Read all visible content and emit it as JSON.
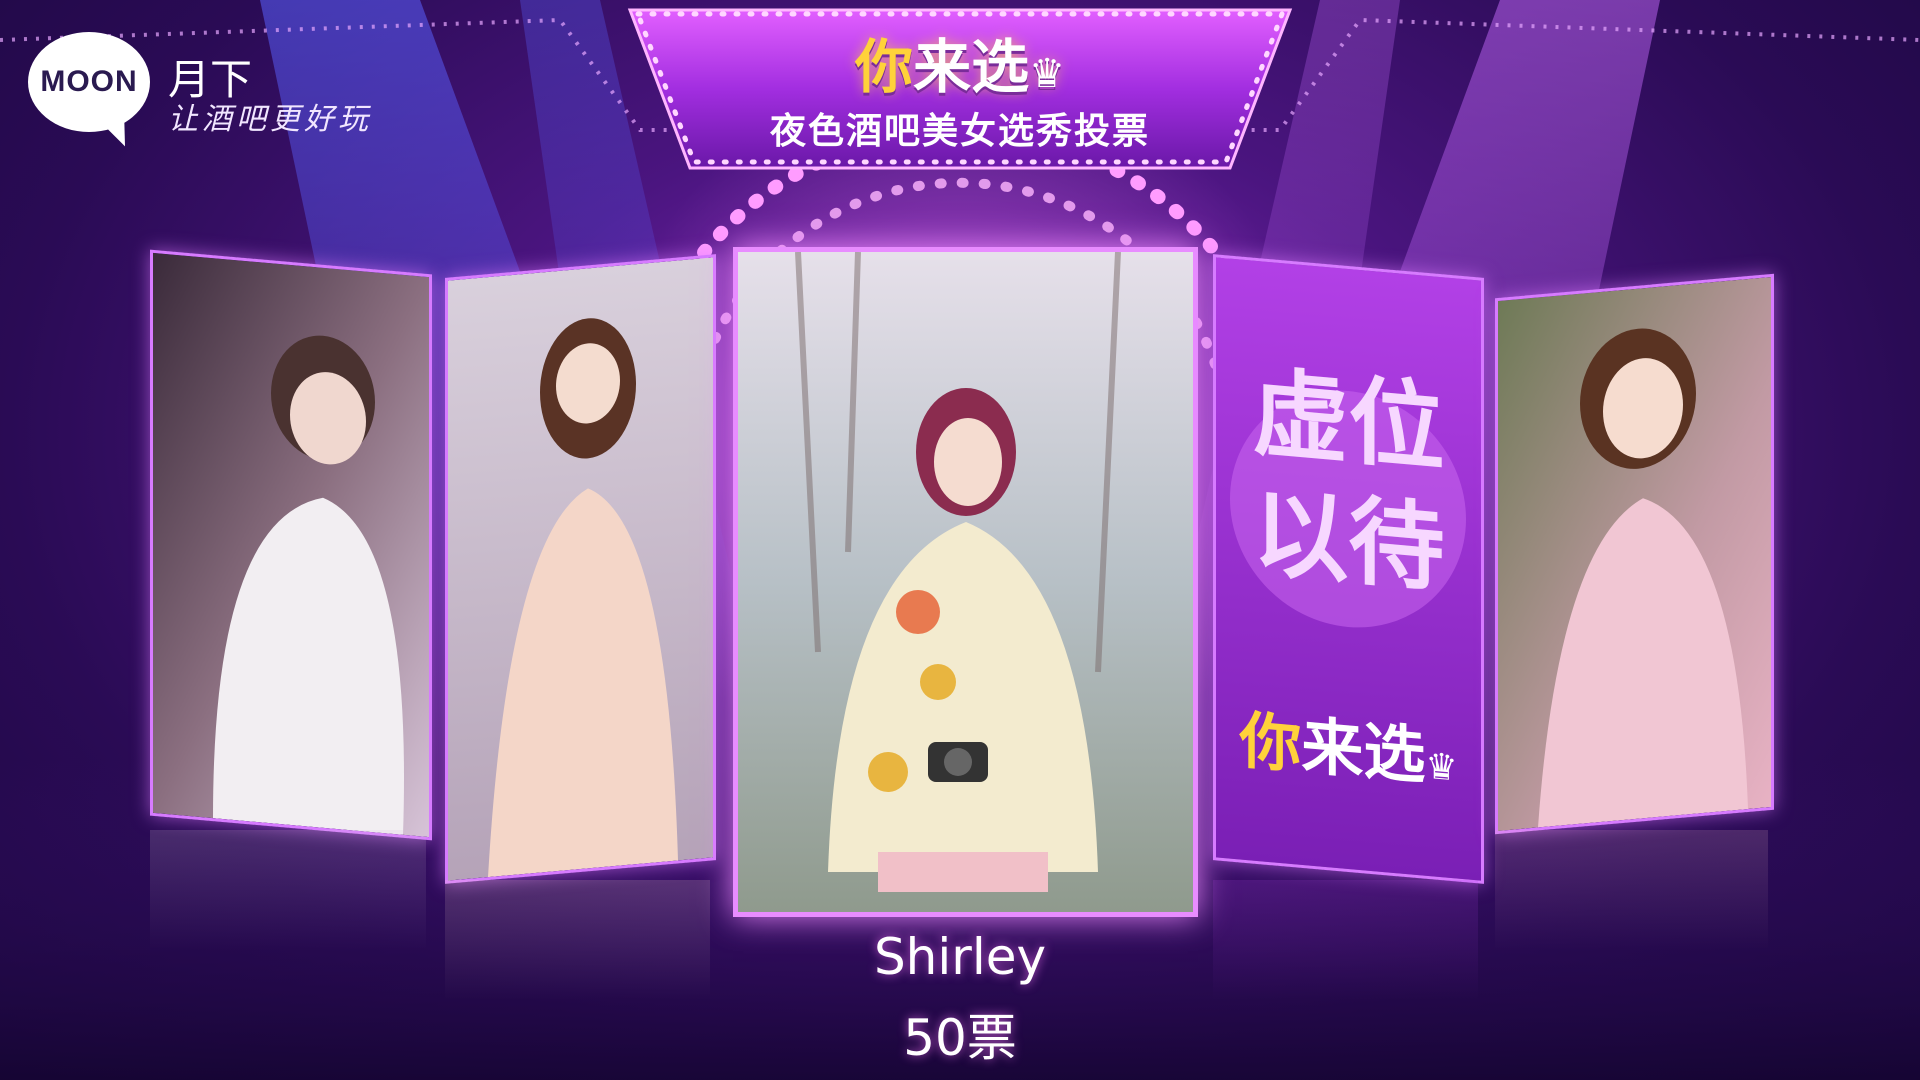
{
  "brand": {
    "logo_text": "MOON",
    "name": "月下",
    "slogan": "让酒吧更好玩"
  },
  "header": {
    "title_highlight": "你",
    "title_rest": "来选",
    "subtitle": "夜色酒吧美女选秀投票"
  },
  "carousel": {
    "placeholder": {
      "text_line1": "虚位",
      "text_line2": "以待",
      "logo_highlight": "你",
      "logo_rest": "来选"
    }
  },
  "selected": {
    "name": "Shirley",
    "votes": "50票"
  },
  "colors": {
    "accent_purple": "#b63fe0",
    "frame_pink": "#e88cff",
    "highlight_yellow": "#ffd23a",
    "background_dark": "#2a0b55"
  }
}
